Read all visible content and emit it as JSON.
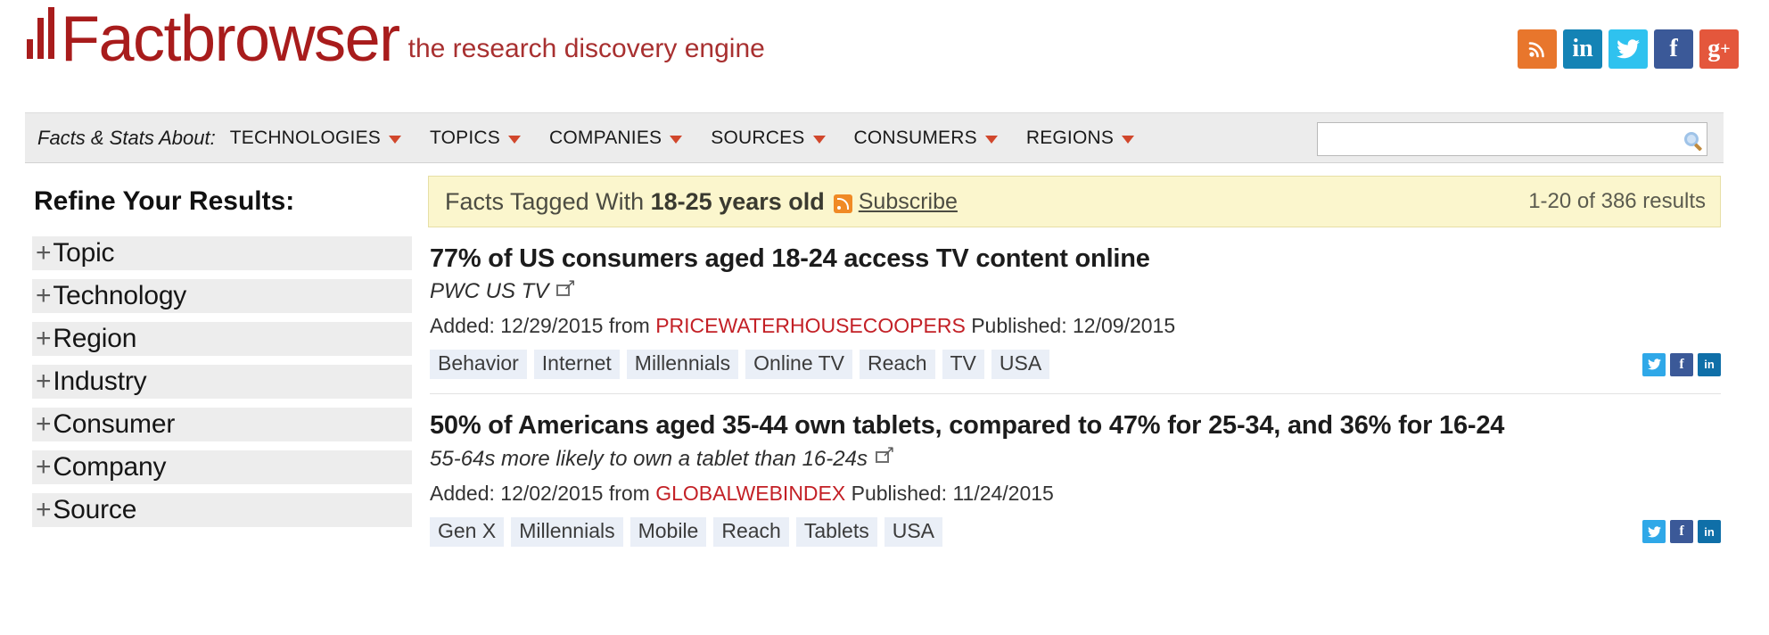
{
  "brand": {
    "name": "Factbrowser",
    "tagline": "the research discovery engine",
    "accent_color": "#a81c1c"
  },
  "social_links": [
    {
      "name": "rss",
      "glyph": "",
      "color": "#e8762c"
    },
    {
      "name": "linkedin",
      "glyph": "in",
      "color": "#1483b5"
    },
    {
      "name": "twitter",
      "glyph": "❈",
      "color": "#2fc2ef"
    },
    {
      "name": "facebook",
      "glyph": "f",
      "color": "#3b5998"
    },
    {
      "name": "googleplus",
      "glyph": "g+",
      "color": "#e4573c"
    }
  ],
  "nav": {
    "label": "Facts & Stats About:",
    "items": [
      {
        "label": "TECHNOLOGIES"
      },
      {
        "label": "TOPICS"
      },
      {
        "label": "COMPANIES"
      },
      {
        "label": "SOURCES"
      },
      {
        "label": "CONSUMERS"
      },
      {
        "label": "REGIONS"
      }
    ]
  },
  "search": {
    "value": "",
    "placeholder": ""
  },
  "sidebar": {
    "title": "Refine Your Results:",
    "facets": [
      {
        "label": "Topic"
      },
      {
        "label": "Technology"
      },
      {
        "label": "Region"
      },
      {
        "label": "Industry"
      },
      {
        "label": "Consumer"
      },
      {
        "label": "Company"
      },
      {
        "label": "Source"
      }
    ]
  },
  "banner": {
    "prefix": "Facts Tagged With",
    "tag": "18-25 years old",
    "subscribe": "Subscribe",
    "results_count": "1-20 of 386 results"
  },
  "results": [
    {
      "title": "77% of US consumers aged 18-24 access TV content online",
      "subtitle": "PWC US TV",
      "added_label": "Added:",
      "added_date": "12/29/2015",
      "from_label": "from",
      "source": "PRICEWATERHOUSECOOPERS",
      "published_label": "Published:",
      "published_date": "12/09/2015",
      "tags": [
        "Behavior",
        "Internet",
        "Millennials",
        "Online TV",
        "Reach",
        "TV",
        "USA"
      ]
    },
    {
      "title": "50% of Americans aged 35-44 own tablets, compared to 47% for 25-34, and 36% for 16-24",
      "subtitle": "55-64s more likely to own a tablet than 16-24s",
      "added_label": "Added:",
      "added_date": "12/02/2015",
      "from_label": "from",
      "source": "GLOBALWEBINDEX",
      "published_label": "Published:",
      "published_date": "11/24/2015",
      "tags": [
        "Gen X",
        "Millennials",
        "Mobile",
        "Reach",
        "Tablets",
        "USA"
      ]
    }
  ],
  "share_buttons": [
    {
      "name": "twitter",
      "glyph": "❈"
    },
    {
      "name": "facebook",
      "glyph": "f"
    },
    {
      "name": "linkedin",
      "glyph": "in"
    }
  ]
}
